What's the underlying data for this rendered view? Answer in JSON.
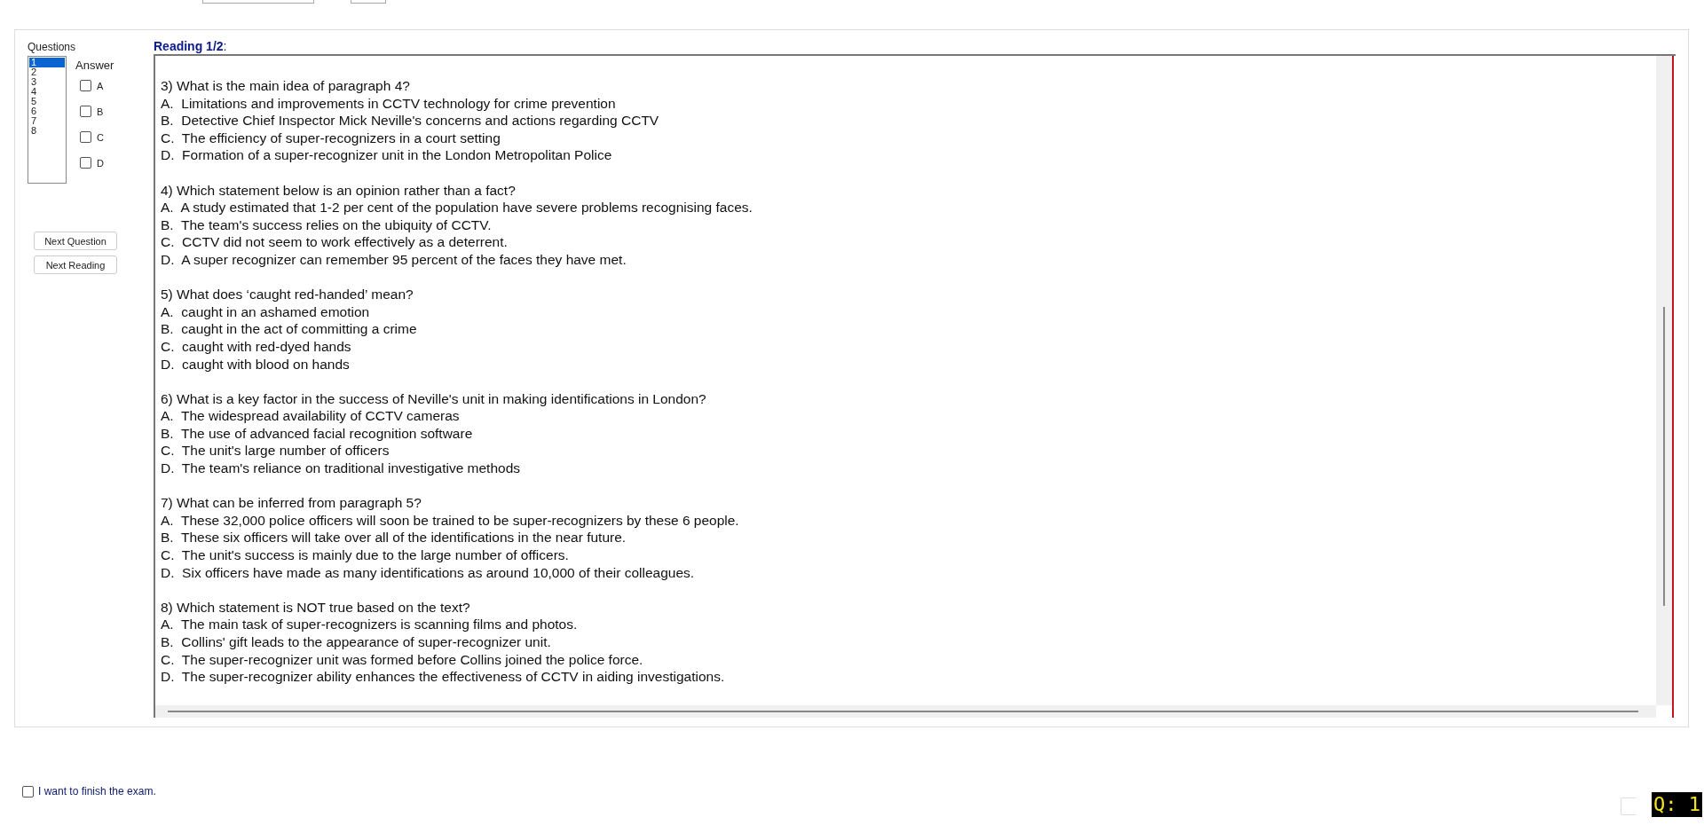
{
  "questions_panel": {
    "title": "Questions",
    "items": [
      {
        "label": "1",
        "selected": true
      },
      {
        "label": "2",
        "selected": false
      },
      {
        "label": "3",
        "selected": false
      },
      {
        "label": "4",
        "selected": false
      },
      {
        "label": "5",
        "selected": false
      },
      {
        "label": "6",
        "selected": false
      },
      {
        "label": "7",
        "selected": false
      },
      {
        "label": "8",
        "selected": false
      }
    ]
  },
  "answer": {
    "title": "Answer",
    "options": [
      {
        "label": "A",
        "checked": false
      },
      {
        "label": "B",
        "checked": false
      },
      {
        "label": "C",
        "checked": false
      },
      {
        "label": "D",
        "checked": false
      }
    ]
  },
  "buttons": [
    "Next Question",
    "Next Reading"
  ],
  "reading": {
    "title": "**Reading 1/2**:",
    "questions": [
      {
        "stem": "3) What is the main idea of paragraph 4?",
        "choices": [
          "A.  Limitations and improvements in CCTV technology for crime prevention",
          "B.  Detective Chief Inspector Mick Neville's concerns and actions regarding CCTV",
          "C.  The efficiency of super-recognizers in a court setting",
          "D.  Formation of a super-recognizer unit in the London Metropolitan Police"
        ]
      },
      {
        "stem": "4) Which statement below is an opinion rather than a fact?",
        "choices": [
          "A.  A study estimated that 1-2 per cent of the population have severe problems recognising faces.",
          "B.  The team's success relies on the ubiquity of CCTV.",
          "C.  CCTV did not seem to work effectively as a deterrent.",
          "D.  A super recognizer can remember 95 percent of the faces they have met."
        ]
      },
      {
        "stem": "5) What does ‘caught red-handed’ mean?",
        "choices": [
          "A.  caught in an ashamed emotion",
          "B.  caught in the act of committing a crime",
          "C.  caught with red-dyed hands",
          "D.  caught with blood on hands"
        ]
      },
      {
        "stem": "6) What is a key factor in the success of Neville's unit in making identifications in London?",
        "choices": [
          "A.  The widespread availability of CCTV cameras",
          "B.  The use of advanced facial recognition software",
          "C.  The unit's large number of officers",
          "D.  The team's reliance on traditional investigative methods"
        ]
      },
      {
        "stem": "7) What can be inferred from paragraph 5?",
        "choices": [
          "A.  These 32,000 police officers will soon be trained to be super-recognizers by these 6 people.",
          "B.  These six officers will take over all of the identifications in the near future.",
          "C.  The unit's success is mainly due to the large number of officers.",
          "D.  Six officers have made as many identifications as around 10,000 of their colleagues."
        ]
      },
      {
        "stem": "8) Which statement is NOT true based on the text?",
        "choices": [
          "A.  The main task of super-recognizers is scanning films and photos.",
          "B.  Collins' gift leads to the appearance of super-recognizer unit.",
          "C.  The super-recognizer unit was formed before Collins joined the police force.",
          "D.  The super-recognizer ability enhances the effectiveness of CCTV in aiding investigations."
        ]
      }
    ]
  },
  "finish": {
    "label": "I want to finish the exam.",
    "checked": false
  },
  "question_indicator": "Q: 1"
}
